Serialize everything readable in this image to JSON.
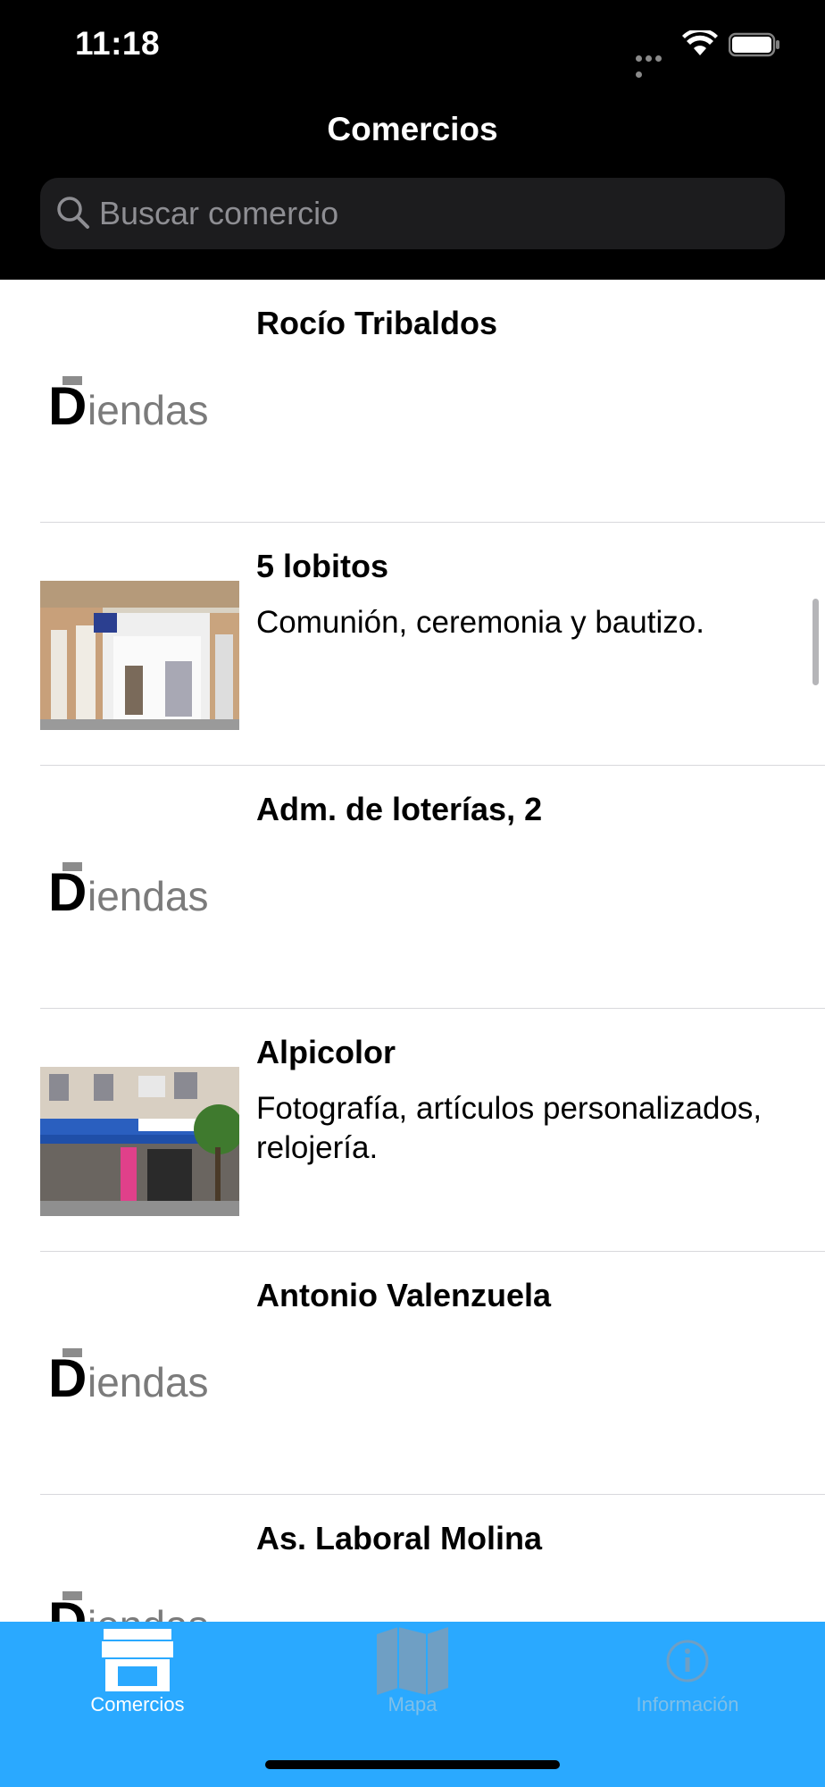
{
  "status_bar": {
    "time": "11:18"
  },
  "nav": {
    "title": "Comercios"
  },
  "search": {
    "placeholder": "Buscar comercio",
    "value": ""
  },
  "logo_text": "Diendas",
  "list": [
    {
      "title": "Rocío Tribaldos",
      "description": "",
      "image": "logo"
    },
    {
      "title": "5 lobitos",
      "description": "Comunión, ceremonia y bautizo.",
      "image": "photo-storefront-corner"
    },
    {
      "title": "Adm. de loterías, 2",
      "description": "",
      "image": "logo"
    },
    {
      "title": "Alpicolor",
      "description": "Fotografía, artículos personalizados, relojería.",
      "image": "photo-storefront-awning"
    },
    {
      "title": "Antonio Valenzuela",
      "description": "",
      "image": "logo"
    },
    {
      "title": "As. Laboral Molina",
      "description": "",
      "image": "logo"
    }
  ],
  "tabs": [
    {
      "label": "Comercios",
      "icon": "store-icon",
      "active": true
    },
    {
      "label": "Mapa",
      "icon": "map-icon",
      "active": false
    },
    {
      "label": "Información",
      "icon": "info-icon",
      "active": false
    }
  ],
  "colors": {
    "tab_bar": "#2aa9ff",
    "header": "#000000",
    "search_field": "#1c1c1e"
  }
}
